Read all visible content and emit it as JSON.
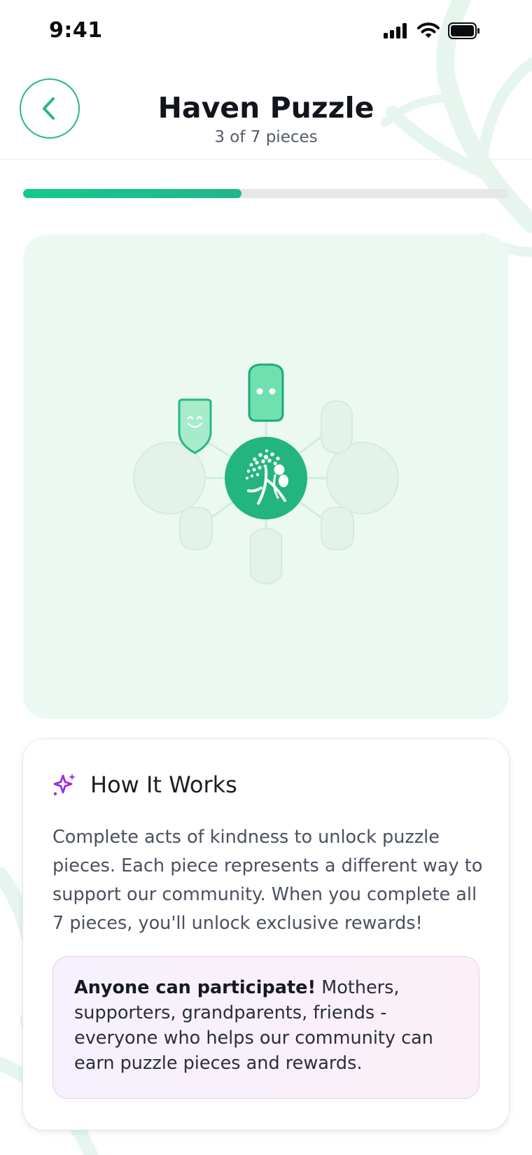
{
  "status_bar": {
    "time": "9:41"
  },
  "header": {
    "title": "Haven Puzzle",
    "subtitle": "3 of 7 pieces",
    "back_icon": "chevron-left-icon"
  },
  "progress": {
    "completed": 3,
    "total": 7,
    "fraction": 0.45
  },
  "puzzle": {
    "center_icon": "tree-of-life-mother-icon",
    "pieces": [
      {
        "slot": "top",
        "unlocked": true,
        "face": "dots"
      },
      {
        "slot": "upper-left",
        "unlocked": true,
        "face": "smile"
      },
      {
        "slot": "upper-right",
        "unlocked": false
      },
      {
        "slot": "left",
        "unlocked": false
      },
      {
        "slot": "right",
        "unlocked": false
      },
      {
        "slot": "lower-left",
        "unlocked": false
      },
      {
        "slot": "lower-right",
        "unlocked": false
      },
      {
        "slot": "bottom",
        "unlocked": false
      }
    ]
  },
  "how_it_works": {
    "icon": "sparkle-icon",
    "title": "How It Works",
    "body": "Complete acts of kindness to unlock puzzle pieces. Each piece represents a different way to support our community. When you complete all 7 pieces, you'll unlock exclusive rewards!",
    "note_bold": "Anyone can participate!",
    "note_text": " Mothers, supporters, grandparents, friends - everyone who helps our community can earn puzzle pieces and rewards."
  },
  "colors": {
    "accent": "#27b884",
    "accent_dark": "#1faa78",
    "sparkle": "#9b2ee0",
    "card_bg": "#ecf9f2"
  }
}
